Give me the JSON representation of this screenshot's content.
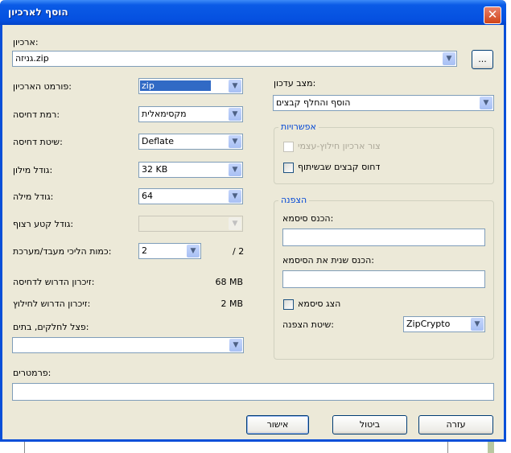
{
  "window": {
    "title": "הוסף לארכיון",
    "close_icon": "close-icon"
  },
  "archive": {
    "label": "ארכיון:",
    "value": "גניזה.zip",
    "browse_label": "..."
  },
  "left": {
    "format": {
      "label": "פורמט הארכיון:",
      "value": "zip"
    },
    "level": {
      "label": "רמת דחיסה:",
      "value": "מקסימאלית"
    },
    "method": {
      "label": "שיטת דחיסה:",
      "value": "Deflate"
    },
    "dictionary": {
      "label": "גודל מילון:",
      "value": "32 KB"
    },
    "word": {
      "label": "גודל מילה:",
      "value": "64"
    },
    "solid": {
      "label": "גודל קטע רצוף:",
      "value": ""
    },
    "threads": {
      "label": "כמות הליכי מעבד/מערכת:",
      "value": "2",
      "max": "/ 2"
    },
    "mem_comp": {
      "label": "זיכרון הדרוש לדחיסה:",
      "value": "68 MB"
    },
    "mem_decomp": {
      "label": "זיכרון הדרוש לחילוץ:",
      "value": "2 MB"
    },
    "split": {
      "label": "פצל לחלקים, בתים:",
      "value": ""
    }
  },
  "right": {
    "update": {
      "label": "מצב עדכון:",
      "value": "הוסף והחלף קבצים"
    },
    "options": {
      "legend": "אפשרויות",
      "sfx": "צור ארכיון חילוץ-עצמי",
      "shared": "דחוס קבצים שבשיתוף"
    },
    "encryption": {
      "legend": "הצפנה",
      "password_label": "הכנס סיסמא:",
      "password": "",
      "reenter_label": "הכנס שנית את הסיסמא:",
      "reenter": "",
      "show_label": "הצג סיסמא",
      "method_label": "שיטת הצפנה:",
      "method": "ZipCrypto"
    }
  },
  "parameters": {
    "label": "פרמטרים:",
    "value": ""
  },
  "buttons": {
    "ok": "אישור",
    "cancel": "ביטול",
    "help": "עזרה"
  }
}
